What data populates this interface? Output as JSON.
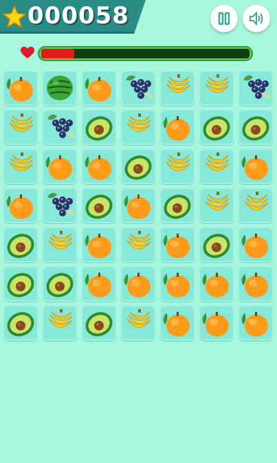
{
  "hud": {
    "score": "000058",
    "lives_icon": "heart-icon",
    "time_remaining_fraction": 0.16,
    "buttons": [
      {
        "icon": "pause-icon"
      },
      {
        "icon": "speaker-icon"
      }
    ]
  },
  "board": {
    "rows": 7,
    "cols": 7,
    "tiles": [
      [
        "orange",
        "watermelon",
        "orange",
        "grapes",
        "banana",
        "banana",
        "grapes"
      ],
      [
        "banana",
        "grapes",
        "avocado",
        "banana",
        "orange",
        "avocado",
        "avocado"
      ],
      [
        "banana",
        "orange",
        "orange",
        "avocado",
        "banana",
        "banana",
        "orange"
      ],
      [
        "orange",
        "grapes",
        "avocado",
        "orange",
        "avocado",
        "banana",
        "banana"
      ],
      [
        "avocado",
        "banana",
        "orange",
        "banana",
        "orange",
        "avocado",
        "orange"
      ],
      [
        "avocado",
        "avocado",
        "orange",
        "orange",
        "orange",
        "orange",
        "orange"
      ],
      [
        "avocado",
        "banana",
        "avocado",
        "banana",
        "orange",
        "orange",
        "orange"
      ]
    ]
  },
  "colors": {
    "background": "#a6f7dc",
    "tile": "#86e8d6",
    "score_panel": "#2b8c86",
    "timer_fill": "#e11a1a"
  }
}
